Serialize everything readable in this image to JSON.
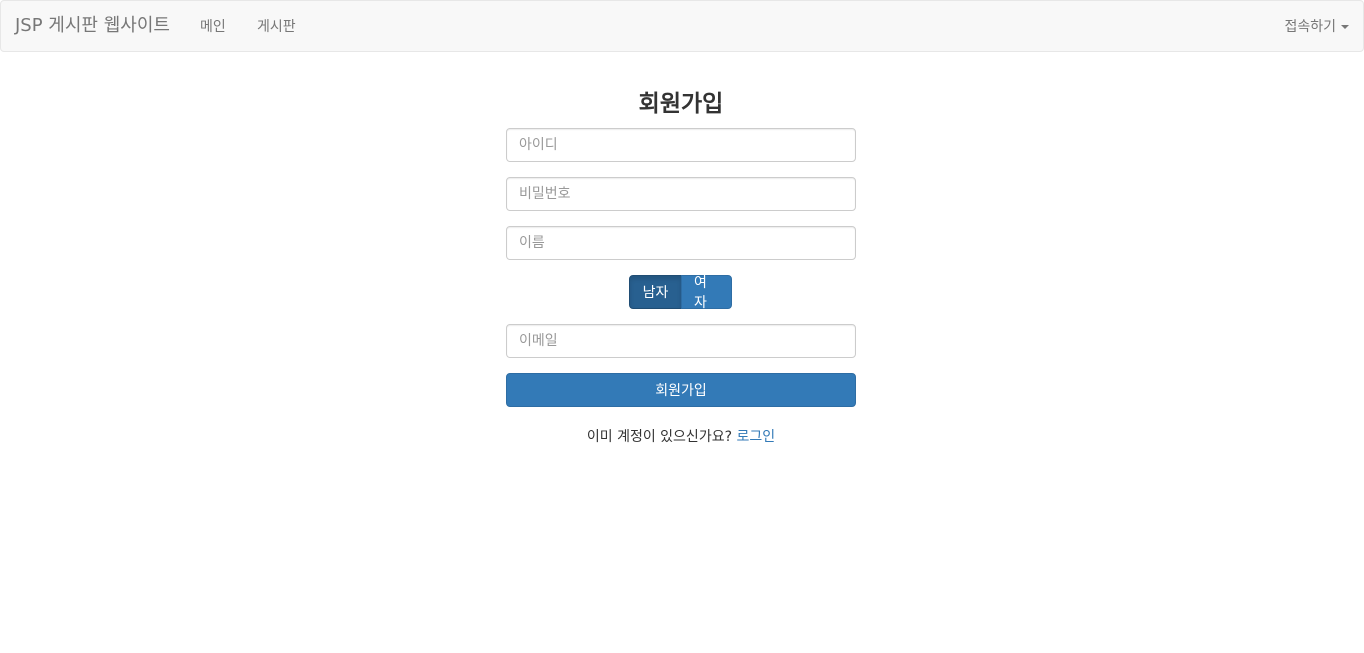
{
  "navbar": {
    "brand": "JSP 게시판 웹사이트",
    "links": [
      {
        "label": "메인"
      },
      {
        "label": "게시판"
      }
    ],
    "dropdown_label": "접속하기"
  },
  "form": {
    "title": "회원가입",
    "id_placeholder": "아이디",
    "password_placeholder": "비밀번호",
    "name_placeholder": "이름",
    "gender_options": [
      {
        "label": "남자",
        "selected": true
      },
      {
        "label": "여자",
        "selected": false
      }
    ],
    "email_placeholder": "이메일",
    "submit_label": "회원가입"
  },
  "footer": {
    "question": "이미 계정이 있으신가요?",
    "login_link": "로그인"
  },
  "colors": {
    "primary": "#337ab7",
    "primary_active": "#286090",
    "navbar_bg": "#f8f8f8",
    "navbar_text": "#777777"
  }
}
